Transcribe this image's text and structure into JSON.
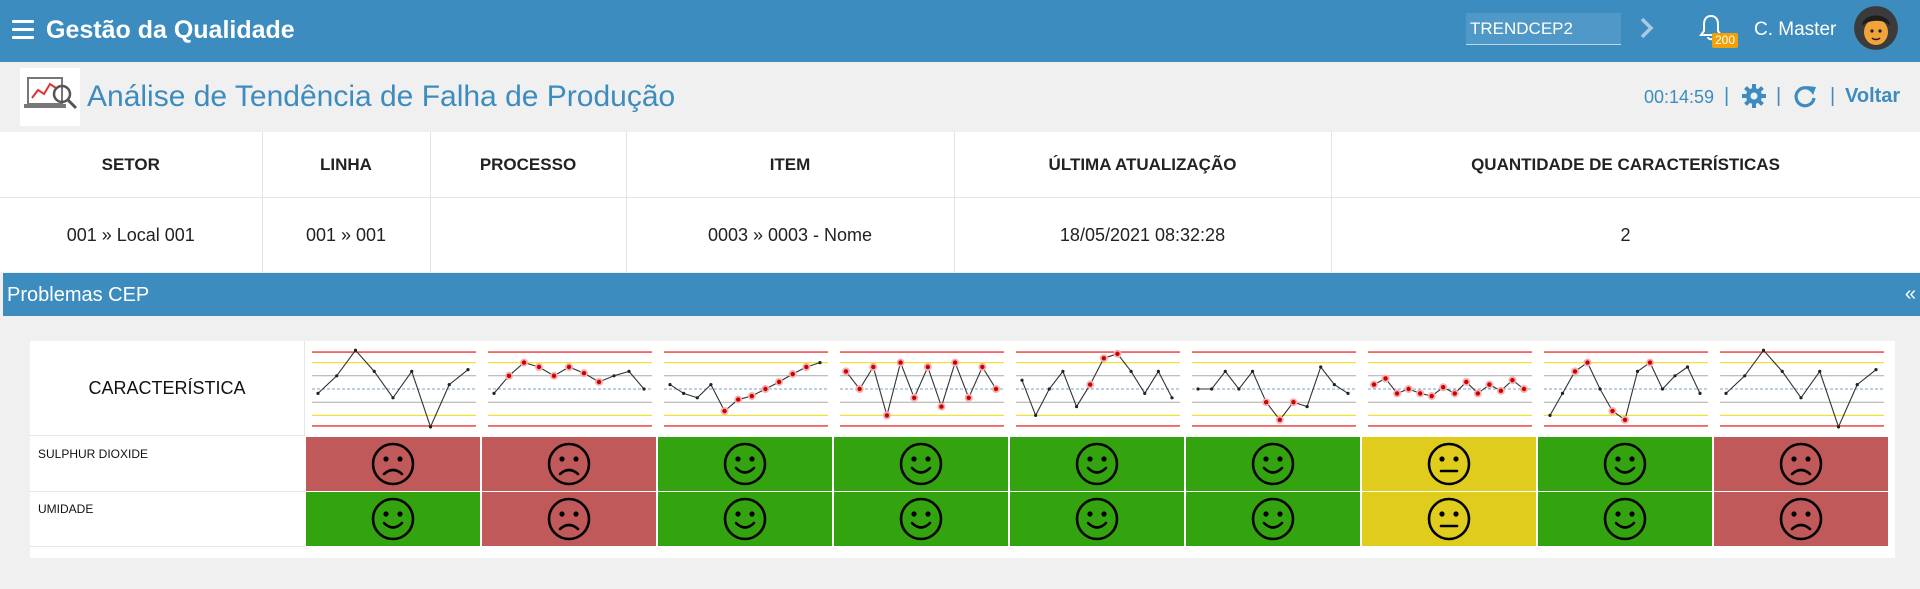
{
  "topbar": {
    "app_title": "Gestão da Qualidade",
    "search_value": "TRENDCEP2",
    "notification_count": "200",
    "user_name": "C. Master"
  },
  "header": {
    "page_title": "Análise de Tendência de Falha de Produção",
    "timer": "00:14:59",
    "back_label": "Voltar",
    "separator": "|"
  },
  "info_table": {
    "headers": [
      "SETOR",
      "LINHA",
      "PROCESSO",
      "ITEM",
      "ÚLTIMA ATUALIZAÇÃO",
      "QUANTIDADE DE CARACTERÍSTICAS"
    ],
    "values": [
      "001 » Local 001",
      "001 » 001",
      "",
      "0003 » 0003 - Nome",
      "18/05/2021 08:32:28",
      "2"
    ]
  },
  "panel": {
    "title": "Problemas CEP",
    "collapse_icon": "«"
  },
  "grid": {
    "header_label": "CARACTERÍSTICA",
    "rows": [
      {
        "label": "SULPHUR DIOXIDE",
        "status": [
          "bad",
          "bad",
          "good",
          "good",
          "good",
          "good",
          "neutral",
          "good",
          "bad"
        ]
      },
      {
        "label": "UMIDADE",
        "status": [
          "good",
          "bad",
          "good",
          "good",
          "good",
          "good",
          "neutral",
          "good",
          "bad"
        ]
      }
    ],
    "status_colors": {
      "good": "#33a40f",
      "bad": "#c05a5a",
      "neutral": "#e0cc1d"
    },
    "trend_patterns": [
      "trend-spike-icon",
      "trend-run-above-icon",
      "trend-increasing-icon",
      "trend-alternating-icon",
      "trend-outlier-high-icon",
      "trend-run-below-icon",
      "trend-stratification-icon",
      "trend-mixture-icon",
      "trend-spike-icon"
    ]
  }
}
